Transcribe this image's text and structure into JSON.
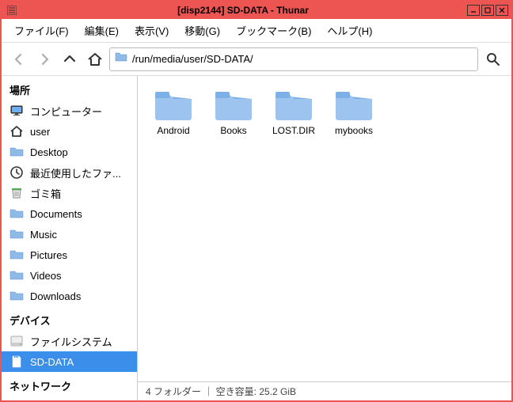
{
  "window": {
    "title": "[disp2144] SD-DATA - Thunar"
  },
  "menubar": {
    "items": [
      "ファイル(F)",
      "編集(E)",
      "表示(V)",
      "移動(G)",
      "ブックマーク(B)",
      "ヘルプ(H)"
    ]
  },
  "toolbar": {
    "path": "/run/media/user/SD-DATA/"
  },
  "sidebar": {
    "sections": [
      {
        "header": "場所",
        "items": [
          {
            "label": "コンピューター",
            "icon": "monitor"
          },
          {
            "label": "user",
            "icon": "home"
          },
          {
            "label": "Desktop",
            "icon": "folder"
          },
          {
            "label": "最近使用したファ...",
            "icon": "clock"
          },
          {
            "label": "ゴミ箱",
            "icon": "trash"
          },
          {
            "label": "Documents",
            "icon": "folder"
          },
          {
            "label": "Music",
            "icon": "folder"
          },
          {
            "label": "Pictures",
            "icon": "folder"
          },
          {
            "label": "Videos",
            "icon": "folder"
          },
          {
            "label": "Downloads",
            "icon": "folder"
          }
        ]
      },
      {
        "header": "デバイス",
        "items": [
          {
            "label": "ファイルシステム",
            "icon": "disk"
          },
          {
            "label": "SD-DATA",
            "icon": "sd",
            "selected": true
          }
        ]
      },
      {
        "header": "ネットワーク",
        "items": []
      }
    ]
  },
  "content": {
    "items": [
      {
        "label": "Android"
      },
      {
        "label": "Books"
      },
      {
        "label": "LOST.DIR"
      },
      {
        "label": "mybooks"
      }
    ]
  },
  "statusbar": {
    "text": "4 フォルダー ｜ 空き容量: 25.2 GiB"
  }
}
